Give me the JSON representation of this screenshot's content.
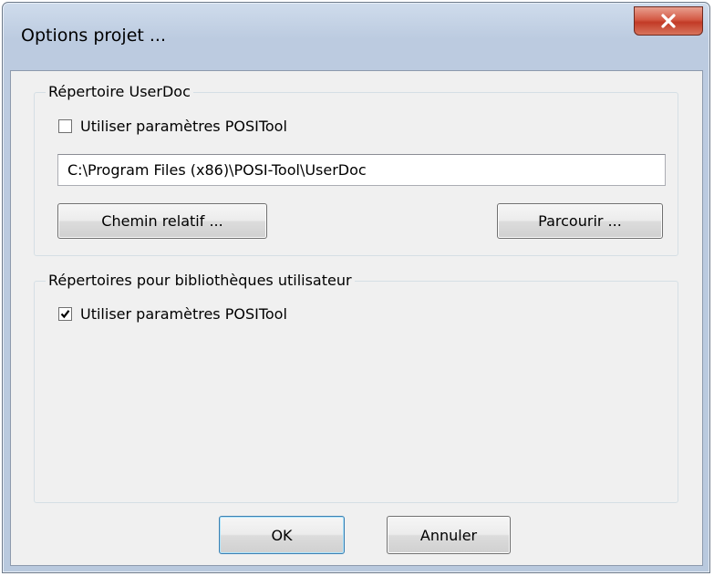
{
  "window": {
    "title": "Options projet ...",
    "close_icon": "close-icon"
  },
  "userdoc_group": {
    "label": "Répertoire UserDoc",
    "checkbox_label": "Utiliser paramètres POSITool",
    "checkbox_checked": false,
    "path_value": "C:\\Program Files (x86)\\POSI-Tool\\UserDoc",
    "relative_path_button": "Chemin relatif ...",
    "browse_button": "Parcourir ..."
  },
  "libraries_group": {
    "label": "Répertoires pour bibliothèques utilisateur",
    "checkbox_label": "Utiliser paramètres POSITool",
    "checkbox_checked": true
  },
  "footer": {
    "ok_button": "OK",
    "cancel_button": "Annuler"
  }
}
